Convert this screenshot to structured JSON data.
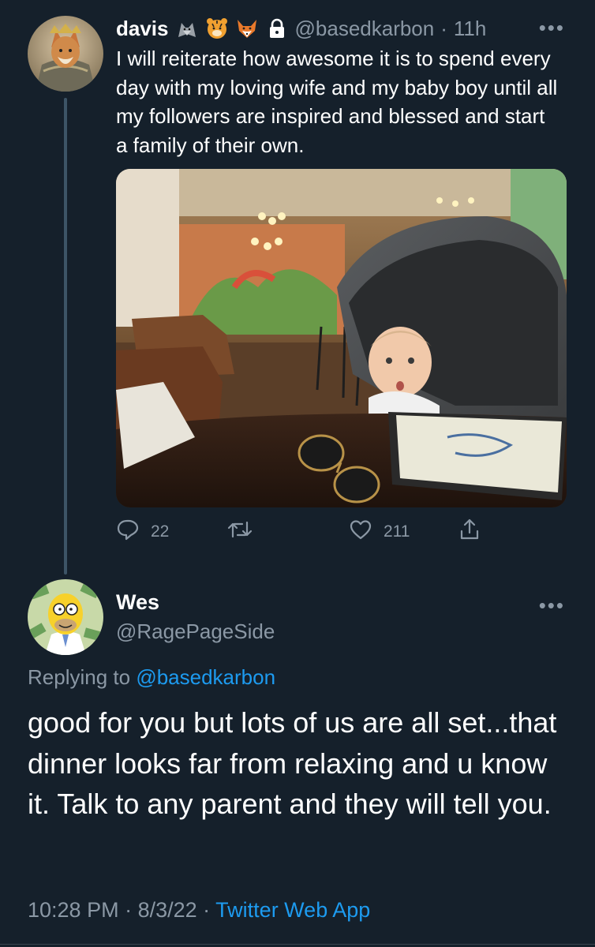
{
  "tweet1": {
    "author_name": "davis",
    "badges": [
      "wolf-emoji",
      "tiger-emoji",
      "fox-emoji",
      "lock-icon"
    ],
    "handle": "@basedkarbon",
    "separator": "·",
    "time": "11h",
    "text": "I will reiterate how awesome it is to spend every day with my loving wife and my baby boy until all my followers are inspired and blessed and start a family of their own.",
    "image_alt": "baby in stroller at restaurant table",
    "replies": "22",
    "likes": "211"
  },
  "tweet2": {
    "author_name": "Wes",
    "handle": "@RagePageSide",
    "replying_prefix": "Replying to ",
    "replying_to": "@basedkarbon",
    "text": "good for you but lots of us are all set...that dinner looks far from relaxing and u know it. Talk to any parent and they will tell you.",
    "time": "10:28 PM",
    "date": "8/3/22",
    "dot": " · ",
    "source": "Twitter Web App"
  },
  "colors": {
    "background": "#15202b",
    "secondary_text": "#8b98a5",
    "link": "#1d9bf0"
  }
}
